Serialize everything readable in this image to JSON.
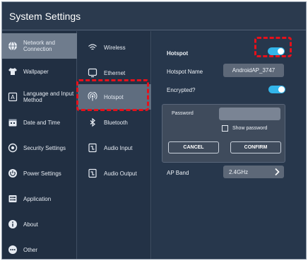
{
  "window": {
    "title": "System Settings"
  },
  "sidebar": {
    "items": [
      {
        "label": "Network and Connection",
        "icon": "globe-icon"
      },
      {
        "label": "Wallpaper",
        "icon": "shirt-icon"
      },
      {
        "label": "Language and Input Method",
        "icon": "keyboard-icon"
      },
      {
        "label": "Date and Time",
        "icon": "calendar-icon"
      },
      {
        "label": "Security Settings",
        "icon": "shield-icon"
      },
      {
        "label": "Power Settings",
        "icon": "power-icon"
      },
      {
        "label": "Application",
        "icon": "apps-icon"
      },
      {
        "label": "About",
        "icon": "info-icon"
      },
      {
        "label": "Other",
        "icon": "more-icon"
      }
    ],
    "selected": "Network and Connection"
  },
  "subnav": {
    "items": [
      {
        "label": "Wireless",
        "icon": "wifi-icon"
      },
      {
        "label": "Ethernet",
        "icon": "monitor-icon"
      },
      {
        "label": "Hotspot",
        "icon": "hotspot-icon"
      },
      {
        "label": "Bluetooth",
        "icon": "bluetooth-icon"
      },
      {
        "label": "Audio Input",
        "icon": "audio-input-icon"
      },
      {
        "label": "Audio Output",
        "icon": "audio-output-icon"
      }
    ],
    "selected": "Hotspot"
  },
  "hotspot": {
    "title": "Hotspot",
    "enabled": true,
    "name_label": "Hotspot Name",
    "name_value": "AndroidAP_3747",
    "encrypted_label": "Encrypted?",
    "encrypted": true,
    "password_label": "Password",
    "password_value": "",
    "show_password_label": "Show password",
    "show_password_checked": false,
    "cancel_label": "CANCEL",
    "confirm_label": "CONFIRM",
    "band_label": "AP Band",
    "band_value": "2.4GHz"
  },
  "colors": {
    "accent": "#33b5ea",
    "highlight": "#e8101a",
    "background": "#243347"
  }
}
